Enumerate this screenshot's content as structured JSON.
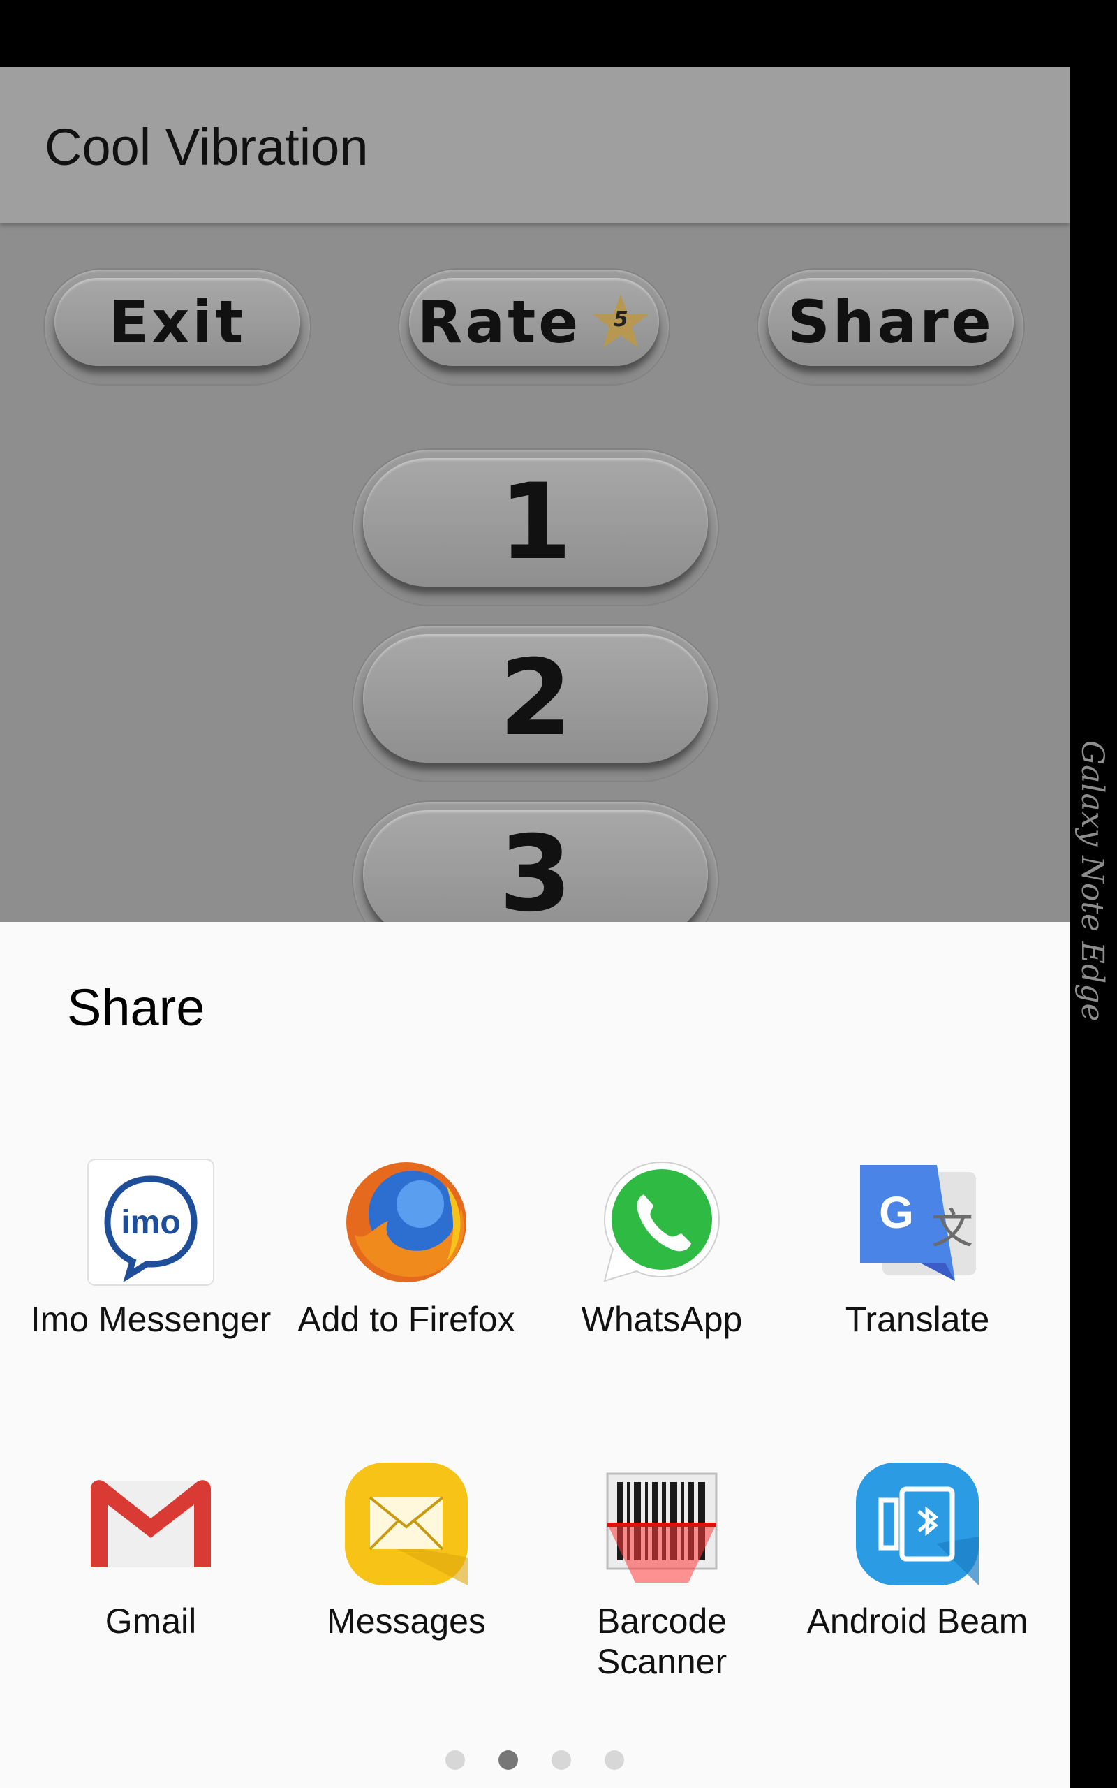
{
  "app": {
    "title": "Cool Vibration",
    "buttons": {
      "exit": "Exit",
      "rate": "Rate",
      "rate_star_number": "5",
      "share": "Share"
    },
    "patterns": [
      "1",
      "2",
      "3"
    ]
  },
  "share_sheet": {
    "title": "Share",
    "apps": [
      {
        "label": "Imo Messenger",
        "icon": "imo-icon"
      },
      {
        "label": "Add to Firefox",
        "icon": "firefox-icon"
      },
      {
        "label": "WhatsApp",
        "icon": "whatsapp-icon"
      },
      {
        "label": "Translate",
        "icon": "google-translate-icon"
      },
      {
        "label": "Gmail",
        "icon": "gmail-icon"
      },
      {
        "label": "Messages",
        "icon": "messages-icon"
      },
      {
        "label": "Barcode Scanner",
        "icon": "barcode-scanner-icon"
      },
      {
        "label": "Android Beam",
        "icon": "android-beam-icon"
      }
    ],
    "pager": {
      "pages": 4,
      "active_page": 2
    }
  },
  "edge_panel": {
    "label": "Galaxy Note Edge"
  },
  "colors": {
    "app_background": "#8e8e8e",
    "app_bar": "#9f9f9f",
    "sheet_background": "#fafafa",
    "whatsapp_green": "#2fbb43",
    "gmail_red": "#d93b34",
    "messages_yellow": "#f6c316",
    "beam_blue": "#2b9be4"
  }
}
